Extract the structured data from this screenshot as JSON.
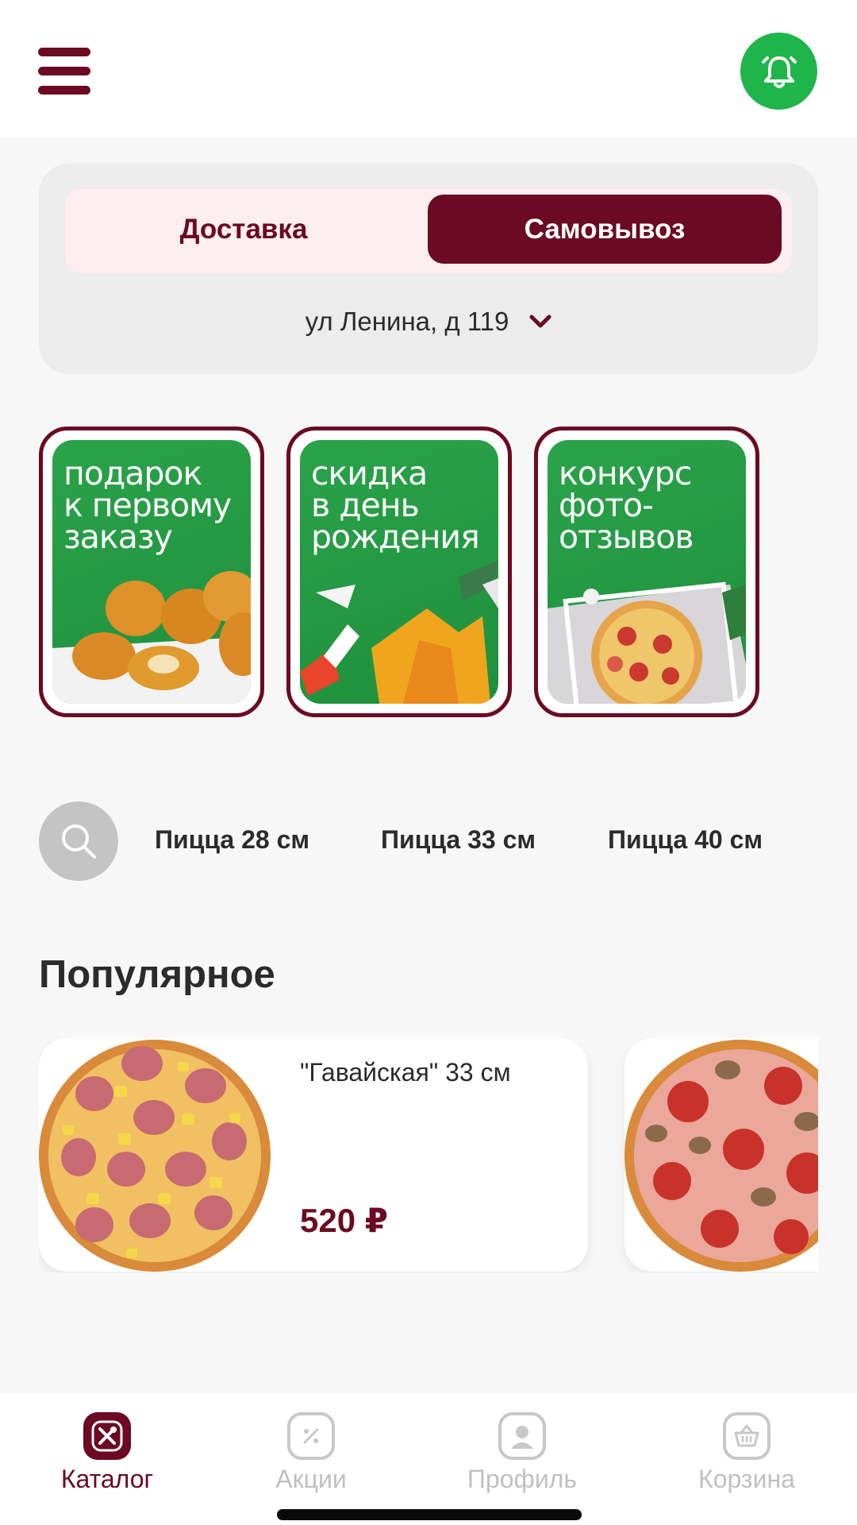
{
  "header": {
    "menu_icon": "hamburger-menu-icon",
    "notification_icon": "bell-icon"
  },
  "delivery": {
    "tabs": [
      {
        "label": "Доставка",
        "active": false
      },
      {
        "label": "Самовывоз",
        "active": true
      }
    ],
    "address": "ул Ленина, д 119"
  },
  "stories": [
    {
      "text": "подарок\nк первому\nзаказу"
    },
    {
      "text": "скидка\nв день\nрождения"
    },
    {
      "text": "конкурс\nфото-\nотзывов"
    }
  ],
  "categories": {
    "search_icon": "search-icon",
    "items": [
      "Пицца 28 см",
      "Пицца 33 см",
      "Пицца 40 см"
    ]
  },
  "popular": {
    "title": "Популярное",
    "products": [
      {
        "name": "\"Гавайская\" 33 см",
        "price": "520 ₽"
      }
    ]
  },
  "tabbar": {
    "items": [
      {
        "label": "Каталог",
        "icon": "fork-knife-icon",
        "active": true
      },
      {
        "label": "Акции",
        "icon": "discount-icon",
        "active": false
      },
      {
        "label": "Профиль",
        "icon": "profile-icon",
        "active": false
      },
      {
        "label": "Корзина",
        "icon": "basket-icon",
        "active": false
      }
    ]
  },
  "colors": {
    "brand": "#6b0a22",
    "accent_green": "#1fb54a",
    "inactive": "#bdbdbd"
  }
}
